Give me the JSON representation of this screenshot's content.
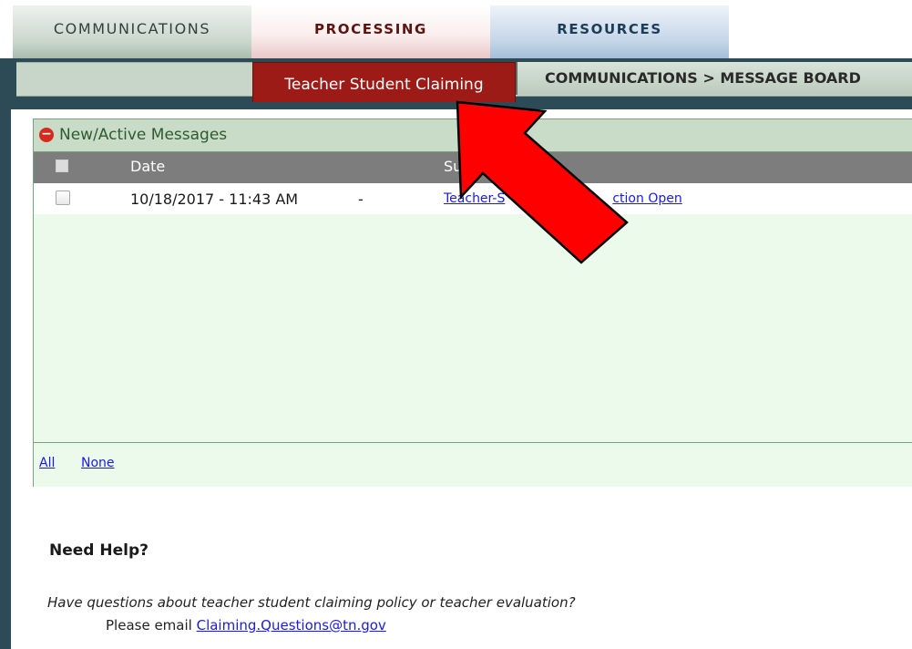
{
  "tabs": {
    "communications": "COMMUNICATIONS",
    "processing": "PROCESSING",
    "resources": "RESOURCES"
  },
  "dropdown": {
    "active_item": "Teacher Student Claiming"
  },
  "breadcrumb": "COMMUNICATIONS > MESSAGE BOARD",
  "messages_panel": {
    "title": "New/Active Messages",
    "columns": [
      "Date",
      "Su"
    ],
    "rows": [
      {
        "date": "10/18/2017 - 11:43 AM",
        "sep": "-",
        "subject_left": "Teacher-S",
        "subject_right": "ction Open"
      }
    ],
    "footer": {
      "all": "All",
      "none": "None"
    }
  },
  "help": {
    "title": "Need Help?",
    "question": "Have questions about teacher student claiming policy or teacher evaluation?",
    "email_prefix": "Please email ",
    "email": "Claiming.Questions@tn.gov"
  },
  "colors": {
    "frame": "#2d4a57",
    "dropdown_bg": "#9c1b17",
    "panel_bg": "#ecfaec",
    "annotation_arrow": "#ff0000"
  },
  "icons": {
    "collapse": "minus-circle-icon",
    "annotation": "red-arrow-icon"
  }
}
